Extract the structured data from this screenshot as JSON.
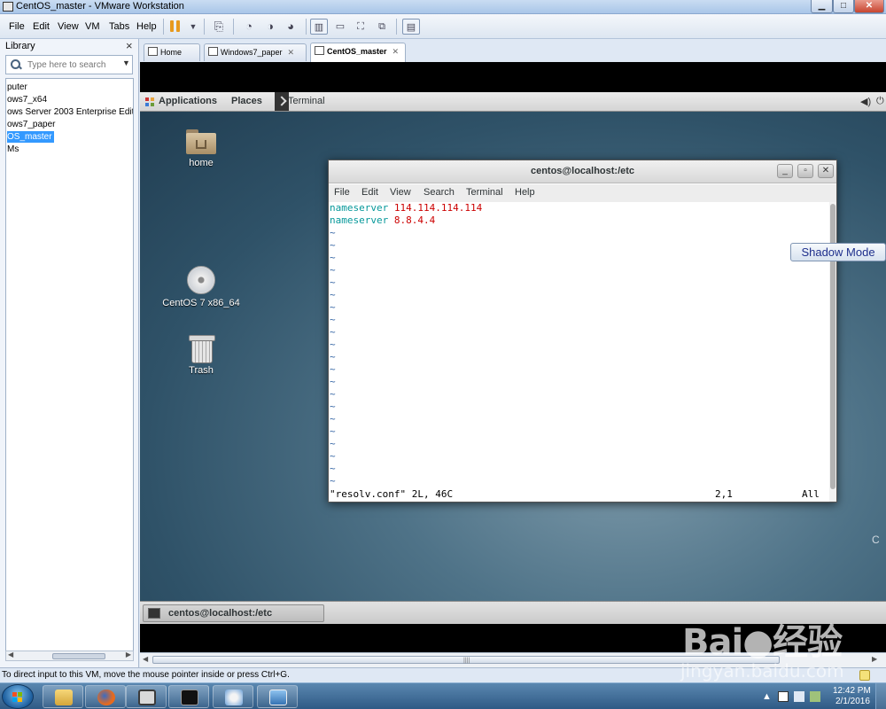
{
  "window": {
    "title": "CentOS_master - VMware Workstation",
    "min_glyph": "▁",
    "max_glyph": "□",
    "close_glyph": "✕"
  },
  "menu": {
    "items": [
      "File",
      "Edit",
      "View",
      "VM",
      "Tabs",
      "Help"
    ]
  },
  "toolbar": {
    "icons": [
      "pause-icon",
      "send-ctrl-alt-del-icon",
      "snapshot-icon",
      "revert-snapshot-icon",
      "snapshot-manager-icon",
      "show-library-icon",
      "quick-switch-icon",
      "fullscreen-icon",
      "unity-icon",
      "console-view-icon"
    ]
  },
  "library": {
    "title": "Library",
    "close_glyph": "×",
    "search_placeholder": "Type here to search",
    "items": [
      {
        "label": "puter",
        "selected": false
      },
      {
        "label": "ows7_x64",
        "selected": false
      },
      {
        "label": "ows Server 2003 Enterprise Edition",
        "selected": false
      },
      {
        "label": "ows7_paper",
        "selected": false
      },
      {
        "label": "OS_master",
        "selected": true
      },
      {
        "label": "Ms",
        "selected": false
      }
    ]
  },
  "tabs": [
    {
      "label": "Home",
      "active": false
    },
    {
      "label": "Windows7_paper",
      "active": false
    },
    {
      "label": "CentOS_master",
      "active": true
    }
  ],
  "tab_close_glyph": "✕",
  "gnome": {
    "applications": "Applications",
    "places": "Places",
    "terminal": "Terminal",
    "volume_glyph": "◀)",
    "power_glyph": "⏻"
  },
  "desktop": {
    "icons": [
      {
        "label": "home"
      },
      {
        "label": "CentOS 7 x86_64"
      },
      {
        "label": "Trash"
      }
    ],
    "edge_char": "C"
  },
  "terminal": {
    "title": "centos@localhost:/etc",
    "menu": [
      "File",
      "Edit",
      "View",
      "Search",
      "Terminal",
      "Help"
    ],
    "lines": [
      {
        "keyword": "nameserver",
        "value": "114.114.114.114"
      },
      {
        "keyword": "nameserver",
        "value": "8.8.4.4"
      }
    ],
    "tilde": "~",
    "tilde_count": 21,
    "status_file": "\"resolv.conf\" 2L, 46C",
    "status_pos": "2,1",
    "status_all": "All",
    "colors": {
      "keyword": "#06989a",
      "value": "#cc0000",
      "tilde": "#3465a4"
    }
  },
  "shadow_mode_label": "Shadow Mode",
  "taskbar_item": "centos@localhost:/etc",
  "statusbar": {
    "text": "To direct input to this VM, move the mouse pointer inside or press Ctrl+G."
  },
  "clock": {
    "time": "12:42 PM",
    "date": "2/1/2016"
  },
  "watermark": {
    "logo": "Bai●经验",
    "url": "jingyan.baidu.com"
  }
}
